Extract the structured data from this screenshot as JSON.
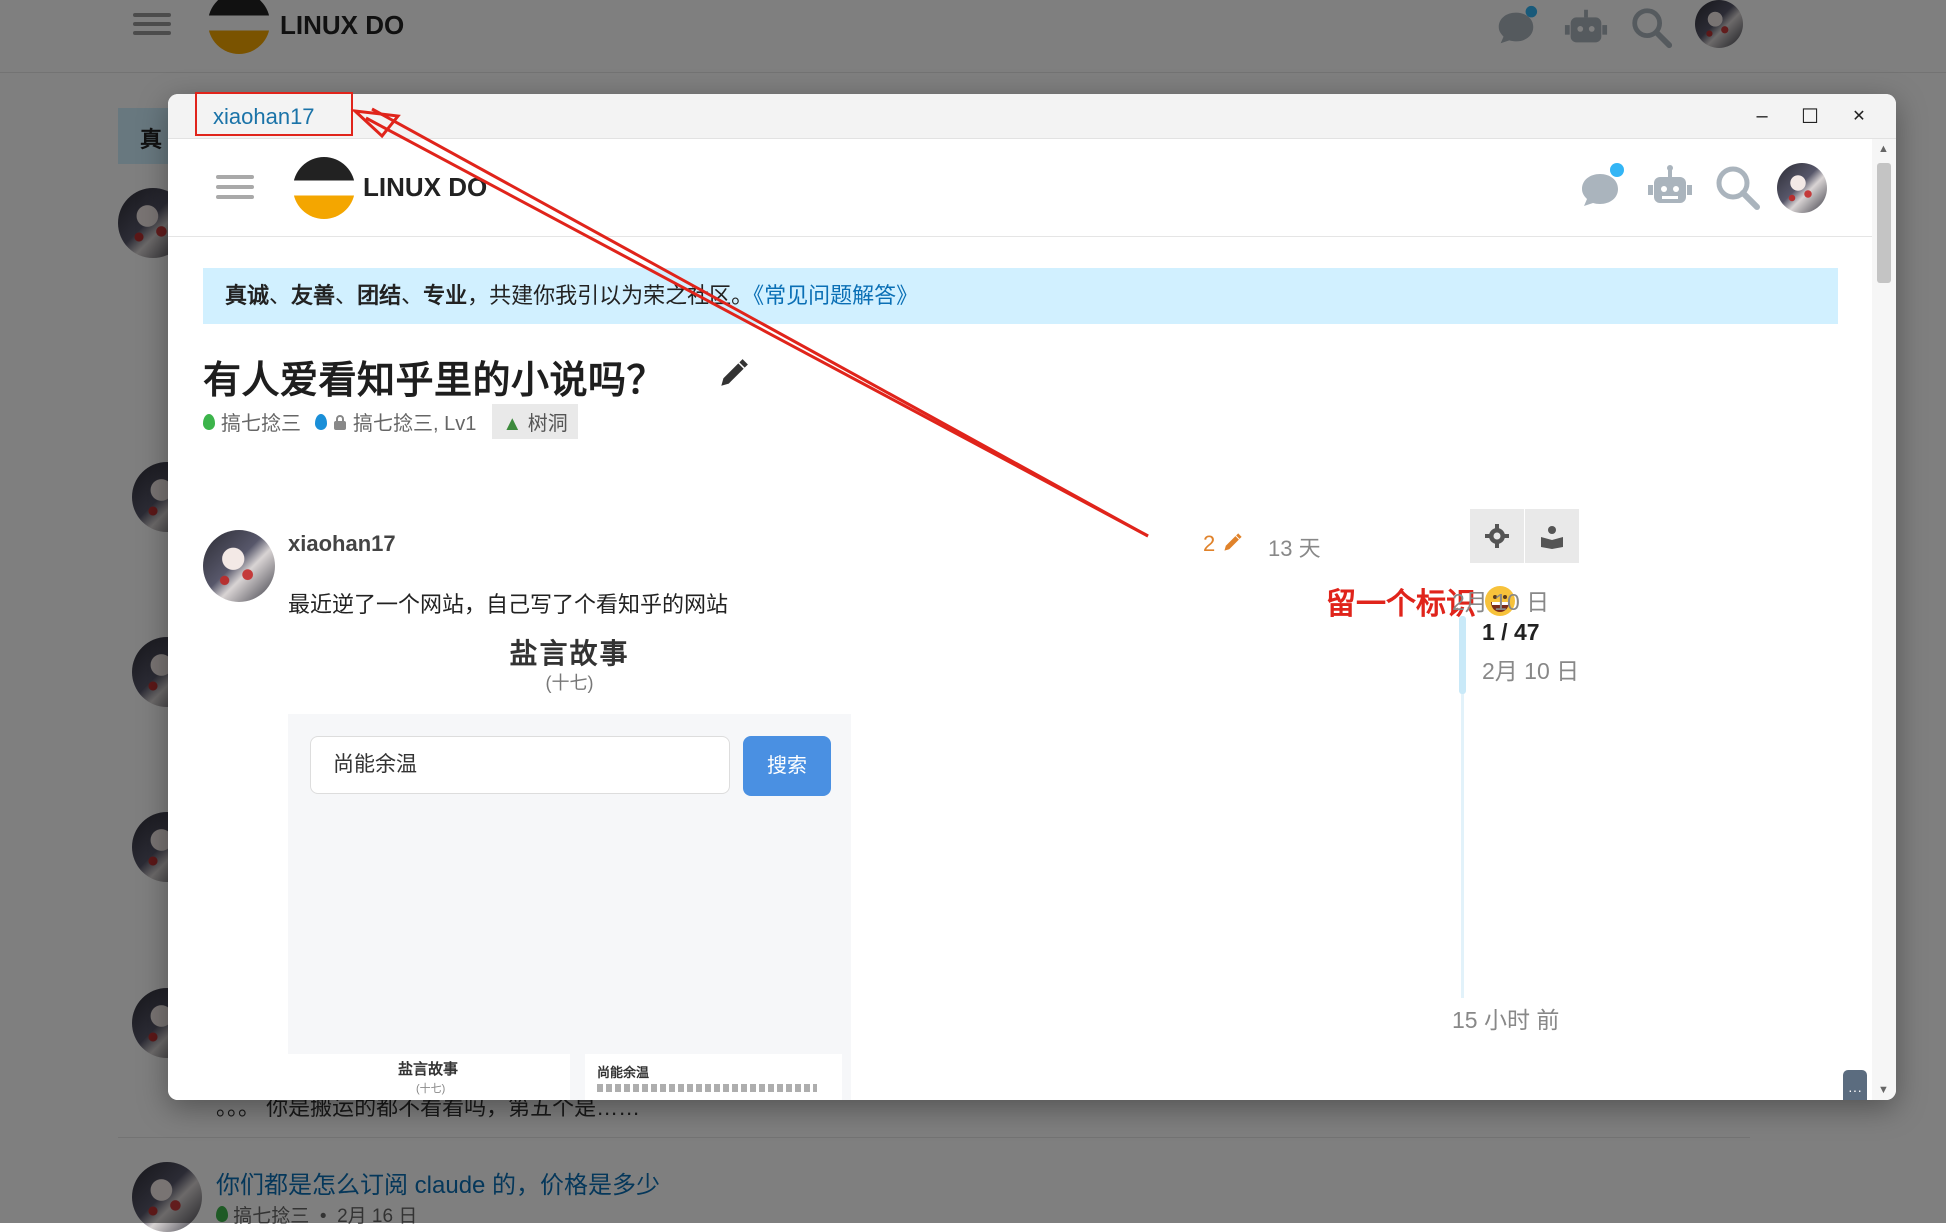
{
  "background": {
    "site_name": "LINUX DO",
    "side_tab_label": "真",
    "topics": [
      {
        "title": "你们都是怎么订阅 claude 的，价格是多少",
        "category": "搞七捻三",
        "date": "2月 16 日"
      }
    ],
    "partial_excerpt": "。。。 你是搬运的都不看看吗，第五个是……"
  },
  "window": {
    "title": "xiaohan17",
    "minimize": "–",
    "maximize": "☐",
    "close": "✕"
  },
  "header": {
    "site_name": "LINUX DO",
    "icons": [
      "chat-icon",
      "robot-icon",
      "search-icon"
    ],
    "notification_color": "#33b5f5"
  },
  "banner": {
    "bold1": "真诚",
    "sep1": "、",
    "bold2": "友善",
    "sep2": "、",
    "bold3": "团结",
    "sep3": "、",
    "bold4": "专业",
    "text": "，共建你我引以为荣之社区。",
    "link": "《常见问题解答》"
  },
  "topic": {
    "title": "有人爱看知乎里的小说吗？",
    "category1": "搞七捻三",
    "category2": "搞七捻三, Lv1",
    "tag": "树洞"
  },
  "post": {
    "username": "xiaohan17",
    "edit_count": "2",
    "age": "13 天",
    "body": "最近逆了一个网站，自己写了个看知乎的网站",
    "story_title": "盐言故事",
    "story_subtitle": "(十七)",
    "search_value": "尚能余温",
    "search_button": "搜索",
    "mini_title_left": "盐言故事",
    "mini_sub_left": "(十七)",
    "mini_title_right": "尚能余温"
  },
  "annotation": {
    "text": "留一个标识",
    "color": "#e0241b"
  },
  "timeline": {
    "top_date": "2月 10 日",
    "position": "1 / 47",
    "position_date": "2月 10 日",
    "bottom_label": "15 小时 前",
    "more": "···"
  }
}
